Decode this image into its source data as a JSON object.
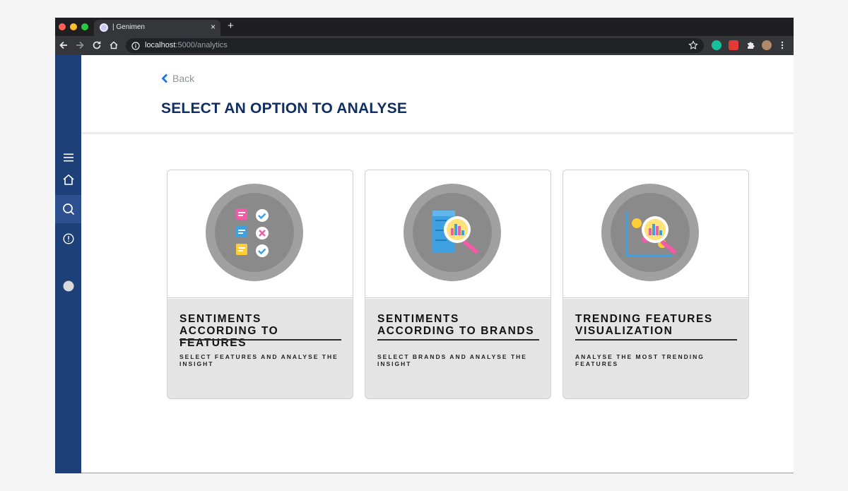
{
  "browser": {
    "tab_title": "| Genimen",
    "url_host": "localhost",
    "url_rest": ":5000/analytics",
    "new_tab": "+",
    "close_tab": "×"
  },
  "sidebar": {
    "items": [
      {
        "name": "menu-icon"
      },
      {
        "name": "home-icon"
      },
      {
        "name": "search-icon",
        "active": true
      },
      {
        "name": "info-icon"
      },
      {
        "name": "user-avatar-icon"
      }
    ],
    "background": "#1e4079",
    "active_background": "#2c5090"
  },
  "header": {
    "back_label": "Back",
    "title": "SELECT AN OPTION TO ANALYSE"
  },
  "cards": [
    {
      "title": "SENTIMENTS ACCORDING TO FEATURES",
      "subtitle": "SELECT FEATURES AND ANALYSE THE INSIGHT",
      "icon": "checklist-icon"
    },
    {
      "title": "SENTIMENTS ACCORDING TO BRANDS",
      "subtitle": "SELECT BRANDS AND ANALYSE THE INSIGHT",
      "icon": "server-analysis-icon"
    },
    {
      "title": "TRENDING FEATURES VISUALIZATION",
      "subtitle": "ANALYSE THE MOST TRENDING FEATURES",
      "icon": "chart-analysis-icon"
    }
  ],
  "colors": {
    "title": "#0f2f63",
    "accent": "#1a73e8",
    "card_body": "#e4e4e4"
  }
}
